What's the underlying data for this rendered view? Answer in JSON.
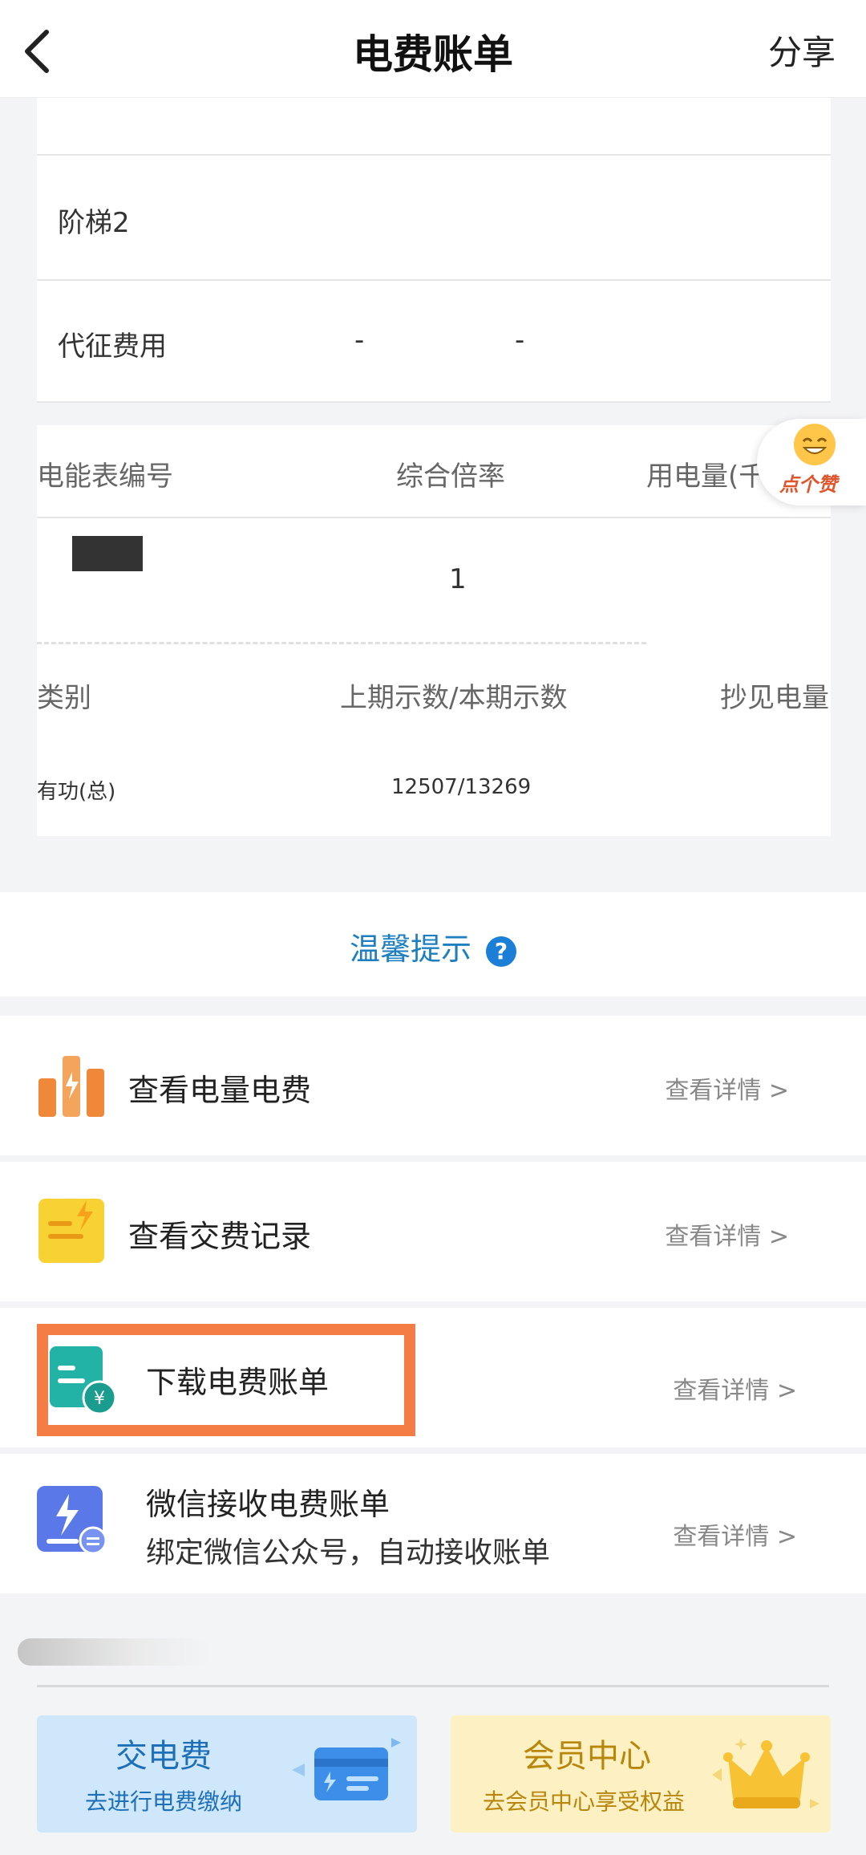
{
  "header": {
    "title": "电费账单",
    "share_label": "分享"
  },
  "tier_table": {
    "rows": [
      {
        "label": "阶梯2"
      },
      {
        "label": "代征费用",
        "values": [
          "-",
          "-"
        ]
      }
    ]
  },
  "meter_table": {
    "headers": [
      "电能表编号",
      "综合倍率",
      "用电量(千"
    ],
    "row": {
      "multiplier": "1"
    }
  },
  "reading_table": {
    "headers": [
      "类别",
      "上期示数/本期示数",
      "抄见电量"
    ],
    "row": {
      "category": "有功(总)",
      "readings": "12507/13269"
    }
  },
  "like_badge": {
    "label": "点个赞"
  },
  "tip": {
    "label": "温馨提示",
    "icon": "?"
  },
  "menu": {
    "items": [
      {
        "label": "查看电量电费",
        "detail": "查看详情 >",
        "icon": "bar-chart-icon"
      },
      {
        "label": "查看交费记录",
        "detail": "查看详情 >",
        "icon": "payment-record-icon"
      },
      {
        "label": "下载电费账单",
        "detail": "查看详情 >",
        "icon": "download-bill-icon"
      },
      {
        "label": "微信接收电费账单",
        "sub": "绑定微信公众号，自动接收账单",
        "detail": "查看详情 >",
        "icon": "wechat-bill-icon"
      }
    ]
  },
  "actions": {
    "pay": {
      "title": "交电费",
      "sub": "去进行电费缴纳"
    },
    "member": {
      "title": "会员中心",
      "sub": "去会员中心享受权益"
    }
  },
  "colors": {
    "accent_blue": "#1d7fbf",
    "highlight": "#f47c45",
    "pay_card_bg": "#cfe7fb",
    "member_card_bg": "#fdf0c2"
  }
}
